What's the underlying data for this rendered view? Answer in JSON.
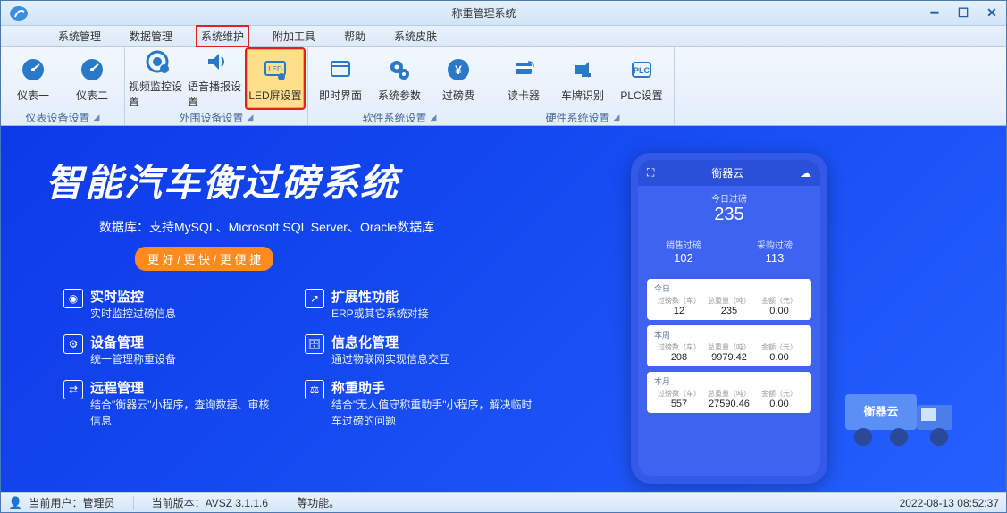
{
  "title": "称重管理系统",
  "menu": {
    "items": [
      "系统管理",
      "数据管理",
      "系统维护",
      "附加工具",
      "帮助",
      "系统皮肤"
    ],
    "highlighted_index": 2
  },
  "ribbon": {
    "groups": [
      {
        "title": "仪表设备设置",
        "buttons": [
          {
            "label": "仪表一",
            "icon": "gauge-icon"
          },
          {
            "label": "仪表二",
            "icon": "gauge-icon"
          }
        ]
      },
      {
        "title": "外围设备设置",
        "buttons": [
          {
            "label": "视频监控设置",
            "icon": "camera-gear-icon"
          },
          {
            "label": "语音播报设置",
            "icon": "speaker-icon"
          },
          {
            "label": "LED屏设置",
            "icon": "led-screen-icon",
            "selected": true
          }
        ]
      },
      {
        "title": "软件系统设置",
        "buttons": [
          {
            "label": "即时界面",
            "icon": "window-icon"
          },
          {
            "label": "系统参数",
            "icon": "gears-icon"
          },
          {
            "label": "过磅费",
            "icon": "money-icon"
          }
        ]
      },
      {
        "title": "硬件系统设置",
        "buttons": [
          {
            "label": "读卡器",
            "icon": "card-reader-icon"
          },
          {
            "label": "车牌识别",
            "icon": "camera-icon"
          },
          {
            "label": "PLC设置",
            "icon": "plc-icon"
          }
        ]
      }
    ]
  },
  "hero": {
    "title": "智能汽车衡过磅系统",
    "subtitle": "数据库：支持MySQL、Microsoft SQL Server、Oracle数据库",
    "badge": "更 好 / 更 快 / 更 便 捷",
    "features": [
      {
        "title": "实时监控",
        "desc": "实时监控过磅信息"
      },
      {
        "title": "扩展性功能",
        "desc": "ERP或其它系统对接"
      },
      {
        "title": "设备管理",
        "desc": "统一管理称重设备"
      },
      {
        "title": "信息化管理",
        "desc": "通过物联网实现信息交互"
      },
      {
        "title": "远程管理",
        "desc": "结合\"衡器云\"小程序，查询数据、审核信息"
      },
      {
        "title": "称重助手",
        "desc": "结合\"无人值守称重助手\"小程序，解决临时车过磅的问题"
      }
    ]
  },
  "phone": {
    "header": "衡器云",
    "today_label": "今日过磅",
    "today_value": "235",
    "sales": {
      "label": "销售过磅",
      "value": "102"
    },
    "purchase": {
      "label": "采购过磅",
      "value": "113"
    },
    "cards": [
      {
        "title": "今日",
        "cols": [
          {
            "label": "过磅数（车）",
            "value": "12"
          },
          {
            "label": "总重量（吨）",
            "value": "235"
          },
          {
            "label": "金额（元）",
            "value": "0.00"
          }
        ]
      },
      {
        "title": "本周",
        "cols": [
          {
            "label": "过磅数（车）",
            "value": "208"
          },
          {
            "label": "总重量（吨）",
            "value": "9979.42"
          },
          {
            "label": "金额（元）",
            "value": "0.00"
          }
        ]
      },
      {
        "title": "本月",
        "cols": [
          {
            "label": "过磅数（车）",
            "value": "557"
          },
          {
            "label": "总重量（吨）",
            "value": "27590.46"
          },
          {
            "label": "金额（元）",
            "value": "0.00"
          }
        ]
      }
    ]
  },
  "truck_label": "衡器云",
  "statusbar": {
    "user_prefix": "当前用户：",
    "user_value": "管理员",
    "version_prefix": "当前版本：",
    "version_value": "AVSZ 3.1.1.6",
    "extra": "ْ等功能。",
    "datetime": "2022-08-13 08:52:37"
  },
  "colors": {
    "accent": "#2a5d9e",
    "ribbon_icon": "#2a78c8",
    "highlight_red": "#d22",
    "selected_bg": "#ffe08a"
  }
}
